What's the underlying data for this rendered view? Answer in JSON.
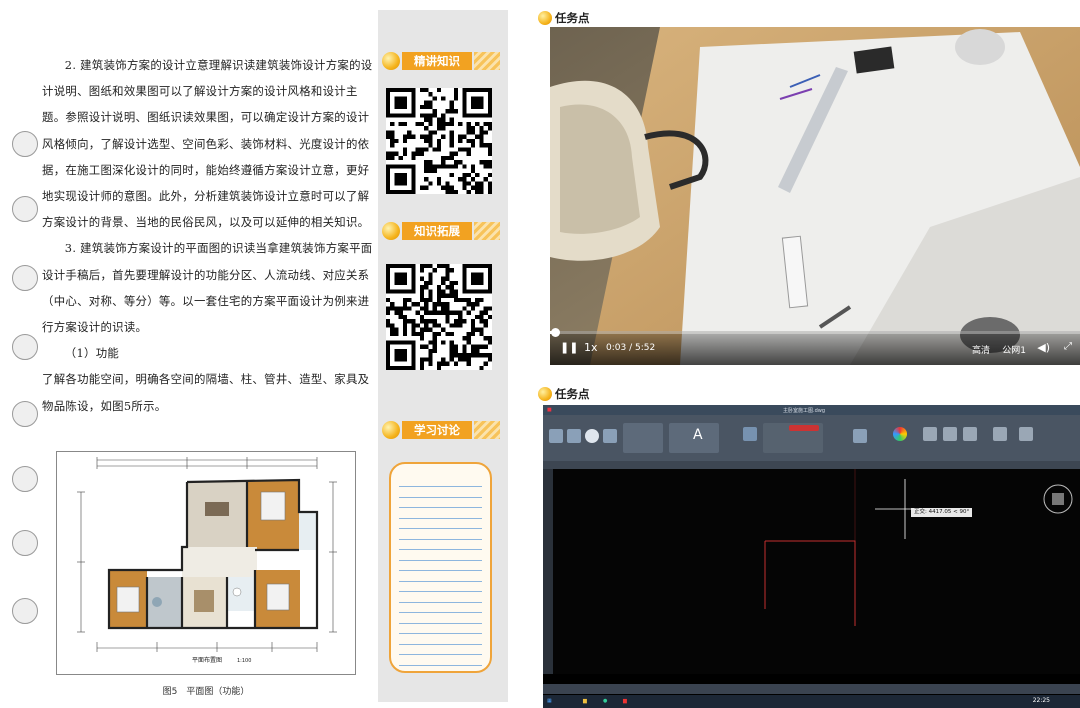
{
  "book": {
    "paragraphs": [
      {
        "text": "2. 建筑装饰方案的设计立意理解识读建筑装饰设计方案的设计说明、图纸和效果图可以了解设计方案的设计风格和设计主题。参照设计说明、图纸识读效果图，可以确定设计方案的设计风格倾向，了解设计选型、空间色彩、装饰材料、光度设计的依据，在施工图深化设计的同时，能始终遵循方案设计立意，更好地实现设计师的意图。此外，分析建筑装饰设计立意时可以了解方案设计的背景、当地的民俗民风，以及可以延伸的相关知识。",
        "indent": true
      },
      {
        "text": "3. 建筑装饰方案设计的平面图的识读当拿建筑装饰方案平面设计手稿后，首先要理解设计的功能分区、人流动线、对应关系（中心、对称、等分）等。以一套住宅的方案平面设计为例来进行方案设计的识读。",
        "indent": true
      },
      {
        "text": "（1）功能",
        "indent": true
      },
      {
        "text": "了解各功能空间，明确各空间的隔墙、柱、管井、造型、家具及物品陈设，如图5所示。",
        "indent": false
      }
    ],
    "sidebar_tags": [
      "精讲知识",
      "知识拓展",
      "学习讨论"
    ],
    "floorplan_label": "平面布置图",
    "floorplan_scale": "1:100",
    "figure_caption": "图5　平面图（功能）"
  },
  "video_panel": {
    "header": "任务点",
    "playback_speed": "1x",
    "time_current": "0:03",
    "time_total": "5:52",
    "time_display": "0:03 / 5:52",
    "progress_fraction": 0.0085,
    "quality_labels": [
      "高清",
      "公网1"
    ]
  },
  "cad_panel": {
    "header": "任务点",
    "file_title": "主卧室施工图.dwg",
    "tooltip": "正交: 4417.05 < 90°",
    "clock": "22:25"
  }
}
